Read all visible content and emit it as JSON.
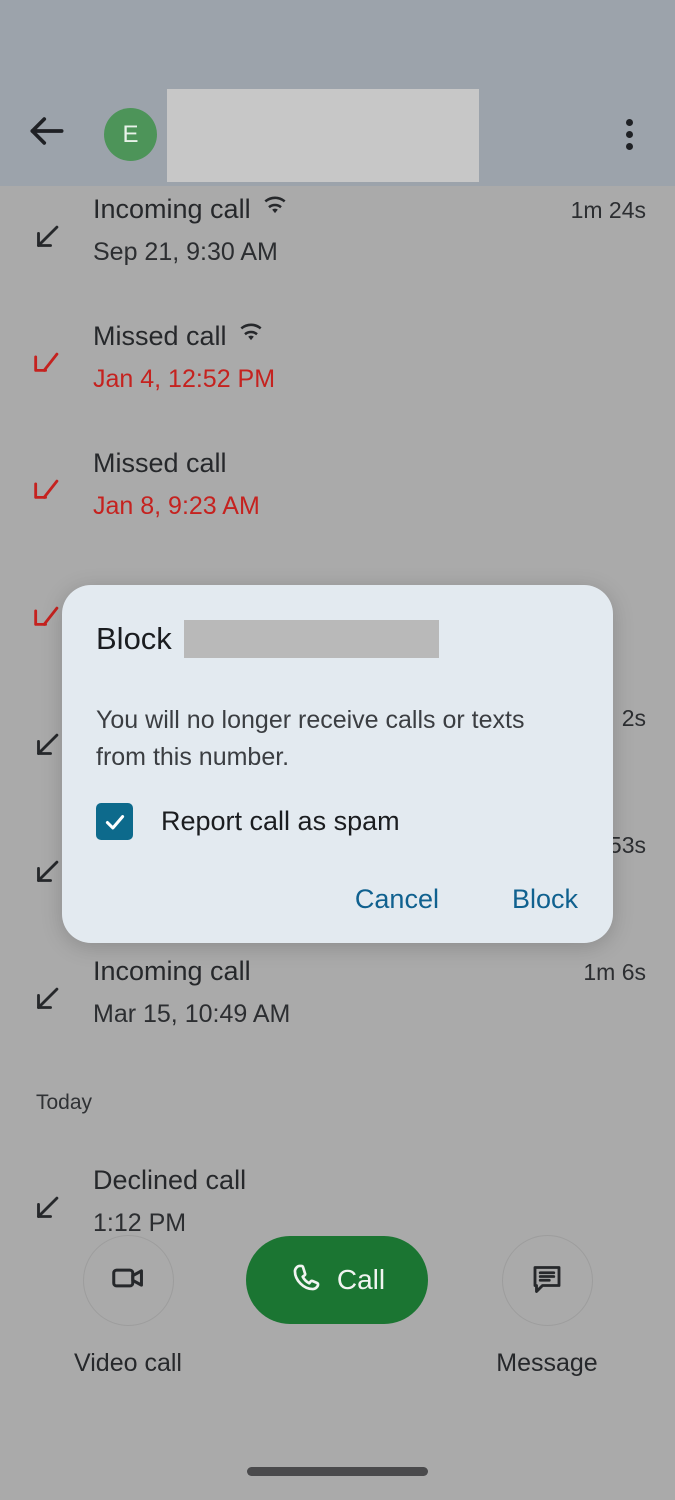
{
  "appbar": {
    "back_icon": "back-arrow-icon",
    "avatar_initial": "E",
    "contact_name_redacted": "",
    "overflow_icon": "more-vert-icon"
  },
  "call_log": {
    "entries": [
      {
        "direction_icon": "incoming-call-arrow-icon",
        "type": "incoming",
        "title": "Incoming call",
        "wifi": true,
        "datetime": "Sep 21, 9:30 AM",
        "duration": "1m 24s"
      },
      {
        "direction_icon": "missed-call-arrow-icon",
        "type": "missed",
        "title": "Missed call",
        "wifi": true,
        "datetime": "Jan 4, 12:52 PM",
        "duration": ""
      },
      {
        "direction_icon": "missed-call-arrow-icon",
        "type": "missed",
        "title": "Missed call",
        "wifi": false,
        "datetime": "Jan 8, 9:23 AM",
        "duration": ""
      },
      {
        "direction_icon": "missed-call-arrow-icon",
        "type": "missed",
        "title": "",
        "wifi": false,
        "datetime": "",
        "duration": ""
      },
      {
        "direction_icon": "incoming-call-arrow-icon",
        "type": "incoming",
        "title": "",
        "wifi": false,
        "datetime": "",
        "duration": "2s"
      },
      {
        "direction_icon": "incoming-call-arrow-icon",
        "type": "incoming",
        "title": "",
        "wifi": false,
        "datetime": "",
        "duration": "53s"
      },
      {
        "direction_icon": "incoming-call-arrow-icon",
        "type": "incoming",
        "title": "Incoming call",
        "wifi": false,
        "datetime": "Mar 15, 10:49 AM",
        "duration": "1m 6s"
      }
    ],
    "section_label": "Today",
    "today_entries": [
      {
        "direction_icon": "declined-call-arrow-icon",
        "type": "declined",
        "title": "Declined call",
        "wifi": false,
        "datetime": "1:12 PM",
        "duration": ""
      }
    ]
  },
  "dialog": {
    "title_prefix": "Block",
    "title_redacted_number": "",
    "body": "You will no longer receive calls or texts from this number.",
    "checkbox_label": "Report call as spam",
    "checkbox_checked": true,
    "cancel_label": "Cancel",
    "confirm_label": "Block"
  },
  "bottom_actions": {
    "video_call_label": "Video call",
    "video_call_icon": "video-camera-icon",
    "call_label": "Call",
    "call_icon": "phone-handset-icon",
    "message_label": "Message",
    "message_icon": "chat-bubble-icon"
  },
  "colors": {
    "appbar_bg": "#9ca3ab",
    "page_bg": "#aaaaaa",
    "avatar_green": "#4d9459",
    "missed_red": "#c5221f",
    "dialog_bg": "#e3eaf0",
    "dialog_accent": "#10618f",
    "checkbox_fill": "#0d6a8c",
    "call_button_green": "#1b7532",
    "redaction_gray": "#b9b9b9"
  }
}
